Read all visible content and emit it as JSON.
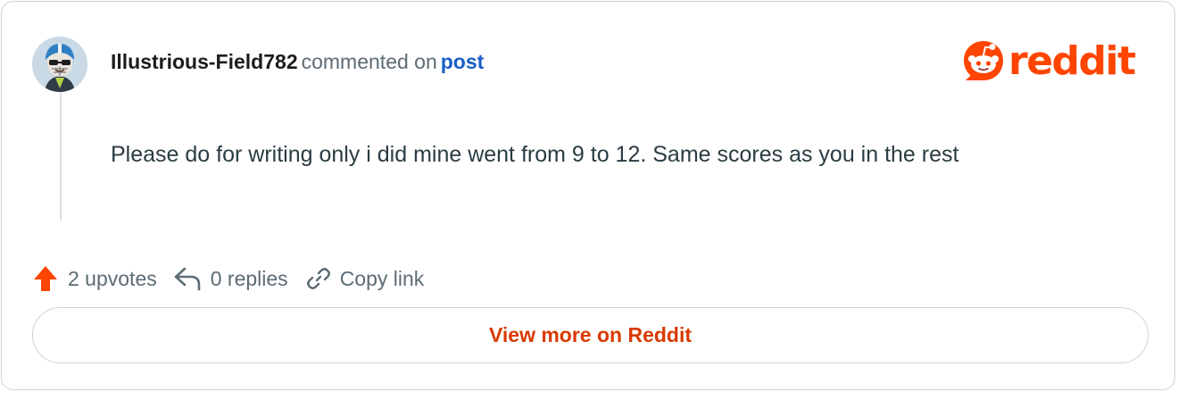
{
  "comment": {
    "username": "Illustrious-Field782",
    "action_text": "commented on",
    "post_link_label": "post",
    "body": "Please do for writing only i did mine went from 9 to 12. Same scores as you in the rest"
  },
  "brand": {
    "wordmark": "reddit",
    "color": "#ff4500",
    "icon": "reddit-snoo-icon"
  },
  "actions": {
    "upvotes_label": "2 upvotes",
    "replies_label": "0 replies",
    "copy_link_label": "Copy link",
    "upvote_icon": "upvote-arrow-icon",
    "reply_icon": "reply-arrow-icon",
    "link_icon": "link-chain-icon"
  },
  "footer": {
    "view_more_label": "View more on Reddit",
    "view_more_color": "#d93a00"
  },
  "colors": {
    "link": "#1a5fc7",
    "muted_text": "#5c6c74",
    "border": "#cfd3d6"
  }
}
